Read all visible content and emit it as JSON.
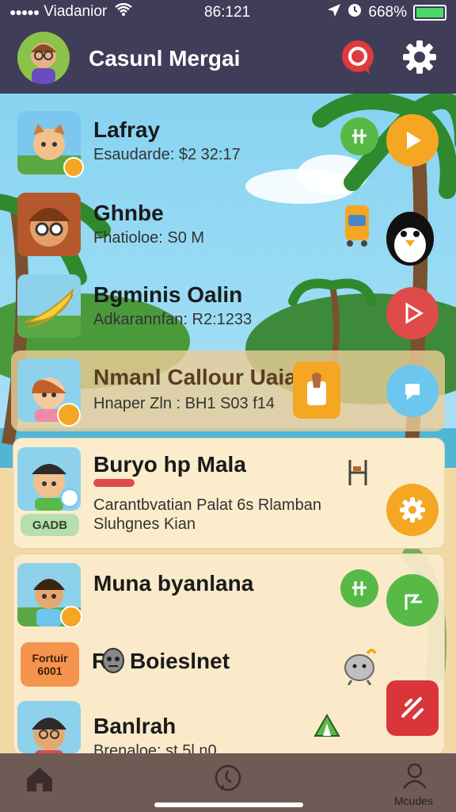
{
  "status": {
    "carrier": "Viadanior",
    "time": "86:121",
    "battery": "668%"
  },
  "header": {
    "title": "Casunl Mergai"
  },
  "rows": [
    {
      "name": "Lafray",
      "sub": "Esaudarde: $2 32:17"
    },
    {
      "name": "Ghnbe",
      "sub": "Fhatioloe: S0 M"
    },
    {
      "name": "Bgminis Oalin",
      "sub": "Adkarannfan: R2:1233"
    },
    {
      "name": "Nmanl Callour Uaiat",
      "sub": "Hnaper Zln : BH1 S03 f14"
    },
    {
      "name": "Buryo hp Mala",
      "sub1": "Carantbvatian Palat 6s Rlamban",
      "sub2": "Sluhgnes Kian",
      "badge": "GADB"
    },
    {
      "name": "Muna byanlana"
    },
    {
      "name": "Boieslnet",
      "prefix": "R",
      "label_line1": "Fortuir",
      "label_line2": "6001"
    },
    {
      "name": "Banlrah",
      "sub": "Brenaloe: st 5l n0"
    }
  ],
  "nav": {
    "profile_label": "Mcudes"
  },
  "colors": {
    "header": "#3f3d58",
    "orange": "#f5a623",
    "red": "#e14a4a",
    "green": "#58b947",
    "blue": "#6cc6ee",
    "cream": "#fbeccc"
  }
}
